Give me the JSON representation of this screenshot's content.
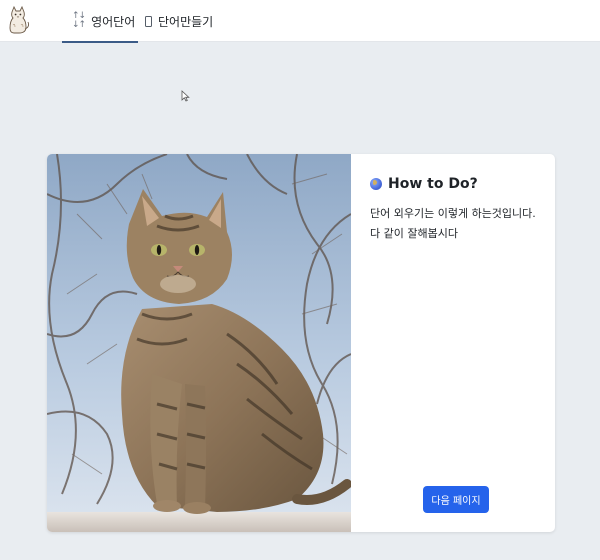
{
  "nav": {
    "logo": "cat-logo",
    "tabs": [
      {
        "label": "영어단어",
        "icon": "sort-icon",
        "active": true
      },
      {
        "label": "단어만들기",
        "icon": "phone-icon",
        "active": false
      }
    ]
  },
  "card": {
    "image": "tabby-cat-photo",
    "title": "How to Do?",
    "title_icon": "globe-icon",
    "description": "단어 외우기는 이렇게 하는것입니다. 다 같이 잘해봅시다",
    "next_button": "다음 페이지"
  },
  "colors": {
    "accent": "#2563eb",
    "page_bg": "#e9edf1",
    "nav_underline": "#3b5b87"
  }
}
